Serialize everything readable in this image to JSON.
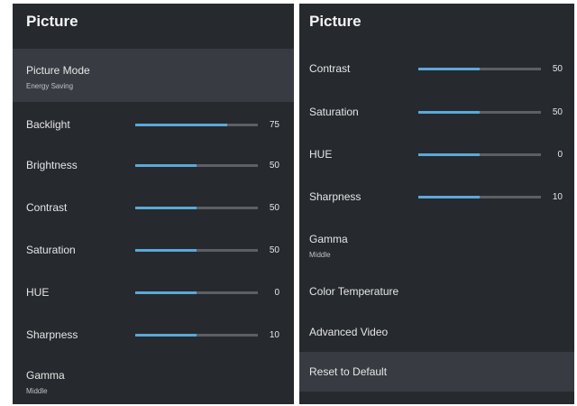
{
  "left": {
    "title": "Picture",
    "picture_mode": {
      "label": "Picture Mode",
      "value": "Energy Saving"
    },
    "sliders": [
      {
        "key": "backlight",
        "label": "Backlight",
        "value": "75",
        "fill": 0.75
      },
      {
        "key": "brightness",
        "label": "Brightness",
        "value": "50",
        "fill": 0.5
      },
      {
        "key": "contrast",
        "label": "Contrast",
        "value": "50",
        "fill": 0.5
      },
      {
        "key": "saturation",
        "label": "Saturation",
        "value": "50",
        "fill": 0.5
      },
      {
        "key": "hue",
        "label": "HUE",
        "value": "0",
        "fill": 0.5
      },
      {
        "key": "sharpness",
        "label": "Sharpness",
        "value": "10",
        "fill": 0.5
      }
    ],
    "gamma": {
      "label": "Gamma",
      "value": "Middle"
    }
  },
  "right": {
    "title": "Picture",
    "sliders": [
      {
        "key": "contrast",
        "label": "Contrast",
        "value": "50",
        "fill": 0.5
      },
      {
        "key": "saturation",
        "label": "Saturation",
        "value": "50",
        "fill": 0.5
      },
      {
        "key": "hue",
        "label": "HUE",
        "value": "0",
        "fill": 0.5
      },
      {
        "key": "sharpness",
        "label": "Sharpness",
        "value": "10",
        "fill": 0.5
      }
    ],
    "gamma": {
      "label": "Gamma",
      "value": "Middle"
    },
    "color_temperature": {
      "label": "Color Temperature"
    },
    "advanced_video": {
      "label": "Advanced Video"
    },
    "reset": {
      "label": "Reset to Default"
    }
  },
  "colors": {
    "panel_bg": "#26292e",
    "highlight_bg": "#383c42",
    "slider_fill": "#5aa9d8",
    "slider_track": "#5c5f63"
  }
}
